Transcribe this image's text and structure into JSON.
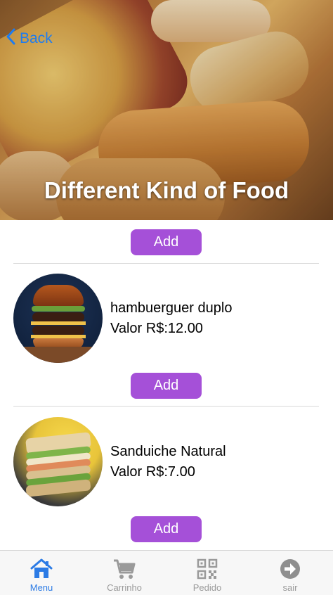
{
  "hero": {
    "title": "Different Kind of Food",
    "back_label": "Back"
  },
  "add_label": "Add",
  "items": [
    {
      "name": "hambuerguer duplo",
      "price": "Valor R$:12.00"
    },
    {
      "name": "Sanduiche Natural",
      "price": "Valor R$:7.00"
    }
  ],
  "tabbar": {
    "tabs": [
      {
        "label": "Menu",
        "icon": "home-icon",
        "active": true
      },
      {
        "label": "Carrinho",
        "icon": "cart-icon",
        "active": false
      },
      {
        "label": "Pedido",
        "icon": "qr-code-icon",
        "active": false
      },
      {
        "label": "sair",
        "icon": "arrow-right-circle-icon",
        "active": false
      }
    ]
  },
  "colors": {
    "accent": "#a550d8",
    "link": "#1e7cf0",
    "tab_active": "#2c7be5",
    "tab_inactive": "#9a9a9a"
  }
}
